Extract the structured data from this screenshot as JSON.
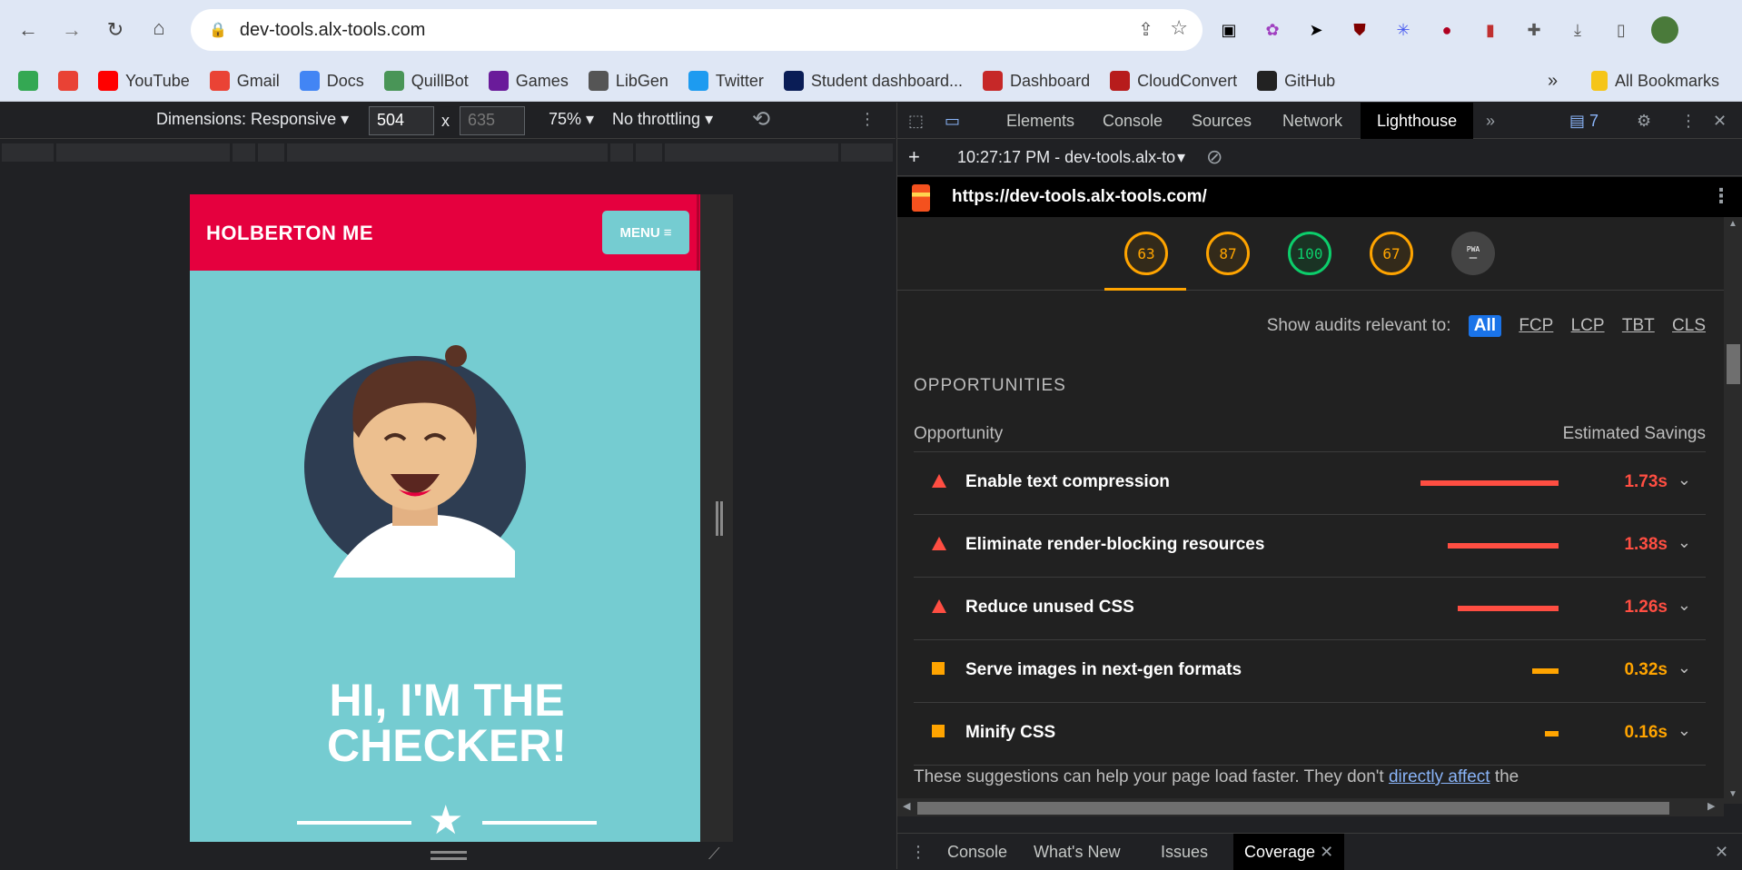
{
  "browser": {
    "url": "dev-tools.alx-tools.com",
    "bookmarks": [
      {
        "label": "",
        "icon": "google-drive-icon"
      },
      {
        "label": "",
        "icon": "app-icon"
      },
      {
        "label": "YouTube",
        "icon": "youtube-icon"
      },
      {
        "label": "Gmail",
        "icon": "gmail-icon"
      },
      {
        "label": "Docs",
        "icon": "docs-icon"
      },
      {
        "label": "QuillBot",
        "icon": "quillbot-icon"
      },
      {
        "label": "Games",
        "icon": "games-icon"
      },
      {
        "label": "LibGen",
        "icon": "libgen-icon"
      },
      {
        "label": "Twitter",
        "icon": "twitter-icon"
      },
      {
        "label": "Student dashboard...",
        "icon": "alx-icon"
      },
      {
        "label": "Dashboard",
        "icon": "dashboard-icon"
      },
      {
        "label": "CloudConvert",
        "icon": "cloudconvert-icon"
      },
      {
        "label": "GitHub",
        "icon": "github-icon"
      }
    ],
    "more_bookmarks": "»",
    "all_bookmarks": "All Bookmarks"
  },
  "device_toolbar": {
    "dimensions": "Dimensions: Responsive",
    "width": "504",
    "height": "635",
    "times": "x",
    "zoom": "75%",
    "throttling": "No throttling"
  },
  "page": {
    "brand": "HOLBERTON ME",
    "menu": "MENU",
    "heading_line1": "HI, I'M THE",
    "heading_line2": "CHECKER!"
  },
  "devtools": {
    "tabs": [
      "Elements",
      "Console",
      "Sources",
      "Network",
      "Lighthouse"
    ],
    "issues_count": "7",
    "report_time": "10:27:17 PM - dev-tools.alx-tools.com",
    "report_url": "https://dev-tools.alx-tools.com/",
    "scores": [
      {
        "value": "63",
        "status": "average"
      },
      {
        "value": "87",
        "status": "average"
      },
      {
        "value": "100",
        "status": "pass"
      },
      {
        "value": "67",
        "status": "average"
      },
      {
        "value": "PWA",
        "status": "na"
      }
    ],
    "filter_label": "Show audits relevant to:",
    "filters": [
      "All",
      "FCP",
      "LCP",
      "TBT",
      "CLS"
    ],
    "opportunities_title": "OPPORTUNITIES",
    "col_opportunity": "Opportunity",
    "col_savings": "Estimated Savings",
    "opportunities": [
      {
        "label": "Enable text compression",
        "savings": "1.73s",
        "severity": "fail",
        "fraction": 1.0
      },
      {
        "label": "Eliminate render-blocking resources",
        "savings": "1.38s",
        "severity": "fail",
        "fraction": 0.8
      },
      {
        "label": "Reduce unused CSS",
        "savings": "1.26s",
        "severity": "fail",
        "fraction": 0.73
      },
      {
        "label": "Serve images in next-gen formats",
        "savings": "0.32s",
        "severity": "average",
        "fraction": 0.19
      },
      {
        "label": "Minify CSS",
        "savings": "0.16s",
        "severity": "average",
        "fraction": 0.1
      }
    ],
    "footnote_pre": "These suggestions can help your page load faster. They don't ",
    "footnote_link": "directly affect",
    "footnote_post": " the",
    "drawer_tabs": [
      "Console",
      "What's New",
      "Issues",
      "Coverage"
    ],
    "colors": {
      "fail": "#ff4e42",
      "average": "#ffa400",
      "pass": "#0cce6b"
    }
  }
}
